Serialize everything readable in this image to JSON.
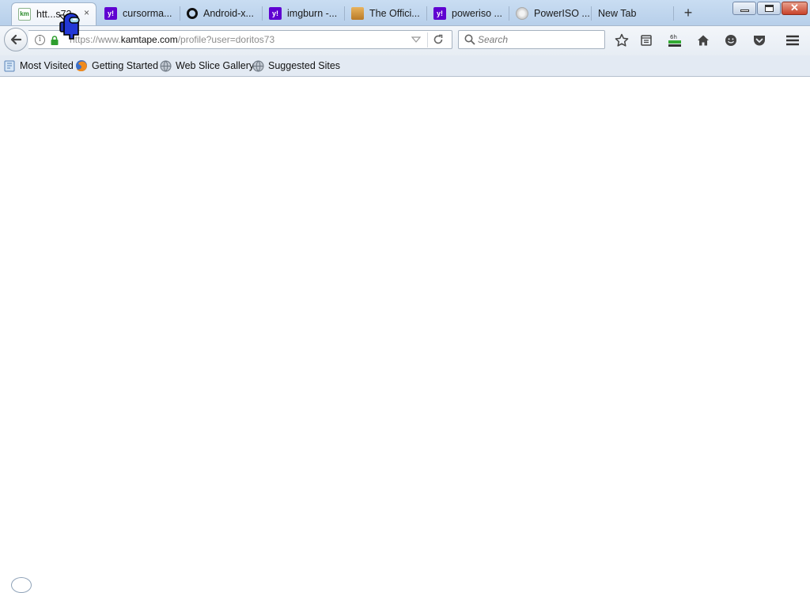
{
  "tabs": [
    {
      "label": "htt...s73",
      "icon": "kamtape-icon",
      "active": true,
      "icon_text": "km"
    },
    {
      "label": "cursorma...",
      "icon": "yahoo-icon",
      "icon_text": "y!"
    },
    {
      "label": "Android-x...",
      "icon": "ring-icon"
    },
    {
      "label": "imgburn -...",
      "icon": "yahoo-icon",
      "icon_text": "y!"
    },
    {
      "label": "The Offici...",
      "icon": "printer-icon"
    },
    {
      "label": "poweriso ...",
      "icon": "yahoo-icon",
      "icon_text": "y!"
    },
    {
      "label": "PowerISO ...",
      "icon": "poweriso-icon"
    },
    {
      "label": "New Tab",
      "icon": "none"
    }
  ],
  "tab_close_glyph": "×",
  "new_tab_glyph": "+",
  "window": {
    "close_glyph": "✕"
  },
  "url": {
    "prefix": "https://www.",
    "domain": "kamtape.com",
    "path": "/profile?user=doritos73"
  },
  "search": {
    "placeholder": "Search"
  },
  "toolbar_icons": [
    "bookmark-star-icon",
    "reading-list-icon",
    "download-icon",
    "home-icon",
    "smiley-icon",
    "pocket-icon",
    "menu-icon"
  ],
  "download_badge": "6h",
  "bookmarks": [
    {
      "label": "Most Visited",
      "icon": "bookmarks-folder-icon"
    },
    {
      "label": "Getting Started",
      "icon": "firefox-icon"
    },
    {
      "label": "Web Slice Gallery",
      "icon": "globe-icon"
    },
    {
      "label": "Suggested Sites",
      "icon": "globe-icon"
    }
  ],
  "colors": {
    "yahoo": "#5f01d1",
    "accent": "#b7cfea"
  }
}
